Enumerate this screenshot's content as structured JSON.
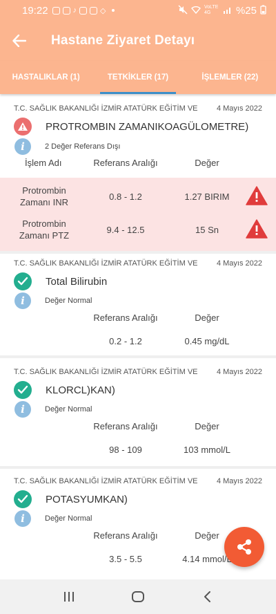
{
  "status_bar": {
    "time": "19:22",
    "network": "VoLTE 4G",
    "battery": "%25"
  },
  "app_bar": {
    "title": "Hastane Ziyaret Detayı"
  },
  "tabs": [
    {
      "label": "HASTALIKLAR (1)",
      "active": false
    },
    {
      "label": "TETKİKLER (17)",
      "active": true
    },
    {
      "label": "İŞLEMLER (22)",
      "active": false
    }
  ],
  "cards": [
    {
      "hospital": "T.C. SAĞLIK BAKANLIĞI İZMİR ATATÜRK EĞİTİM VE",
      "date": "4 Mayıs 2022",
      "status": "warning",
      "test_name": "PROTROMBIN ZAMANIKOAGÜLOMETRE)",
      "info": "2 Değer Referans Dışı",
      "headers": {
        "name": "İşlem Adı",
        "range": "Referans Aralığı",
        "value": "Değer"
      },
      "rows": [
        {
          "name_line1": "Protrombin",
          "name_line2": "Zamanı INR",
          "range": "0.8 - 1.2",
          "value": "1.27 BIRIM",
          "abnormal": true
        },
        {
          "name_line1": "Protrombin",
          "name_line2": "Zamanı PTZ",
          "range": "9.4 - 12.5",
          "value": "15 Sn",
          "abnormal": true
        }
      ]
    },
    {
      "hospital": "T.C. SAĞLIK BAKANLIĞI İZMİR ATATÜRK EĞİTİM VE",
      "date": "4 Mayıs 2022",
      "status": "normal",
      "test_name": "Total Bilirubin",
      "info": "Değer Normal",
      "headers": {
        "range": "Referans Aralığı",
        "value": "Değer"
      },
      "range": "0.2 - 1.2",
      "value": "0.45 mg/dL"
    },
    {
      "hospital": "T.C. SAĞLIK BAKANLIĞI İZMİR ATATÜRK EĞİTİM VE",
      "date": "4 Mayıs 2022",
      "status": "normal",
      "test_name": "KLORCL)KAN)",
      "info": "Değer Normal",
      "headers": {
        "range": "Referans Aralığı",
        "value": "Değer"
      },
      "range": "98 - 109",
      "value": "103 mmol/L"
    },
    {
      "hospital": "T.C. SAĞLIK BAKANLIĞI İZMİR ATATÜRK EĞİTİM VE",
      "date": "4 Mayıs 2022",
      "status": "normal",
      "test_name": "POTASYUMKAN)",
      "info": "Değer Normal",
      "headers": {
        "range": "Referans Aralığı",
        "value": "Değer"
      },
      "range": "3.5 - 5.5",
      "value": "4.14 mmol/L"
    }
  ],
  "colors": {
    "header": "#fcb58f",
    "tab_indicator": "#3d8fc8",
    "warning": "#eb6f6f",
    "abnormal_bg": "#fce3e3",
    "normal": "#23ae8f",
    "info": "#8fbde0",
    "fab": "#f25b34"
  },
  "icons": {
    "back": "arrow-left-icon",
    "warning": "warning-icon",
    "check": "check-icon",
    "info": "info-icon",
    "share": "share-icon",
    "nav_recents": "recents-icon",
    "nav_home": "home-icon",
    "nav_back": "back-chevron-icon"
  }
}
